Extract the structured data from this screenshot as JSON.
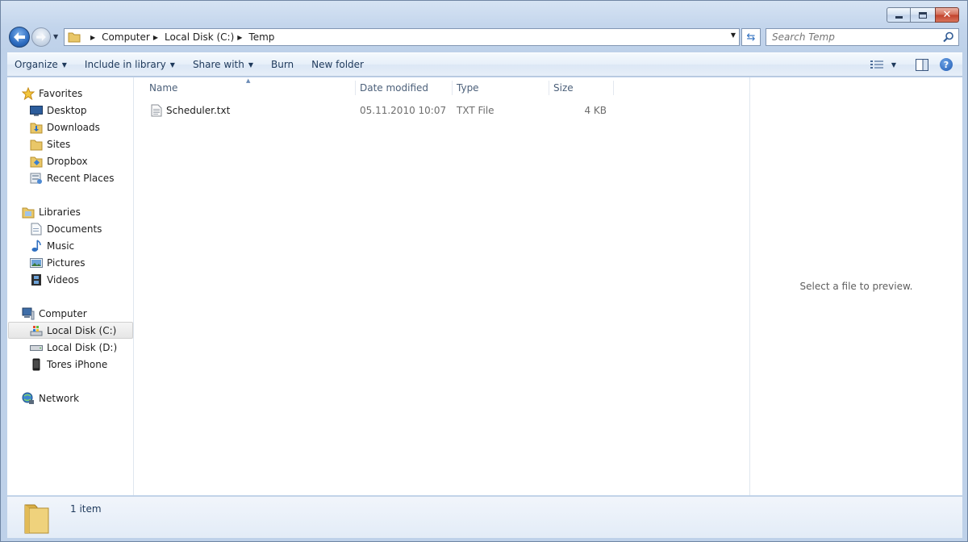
{
  "window": {
    "caption_buttons": [
      "minimize-icon",
      "maximize-icon",
      "close-icon"
    ]
  },
  "address_bar": {
    "breadcrumbs": [
      "Computer",
      "Local Disk (C:)",
      "Temp"
    ]
  },
  "search": {
    "placeholder": "Search Temp"
  },
  "toolbar": {
    "organize_label": "Organize",
    "include_label": "Include in library",
    "share_label": "Share with",
    "burn_label": "Burn",
    "new_folder_label": "New folder"
  },
  "sidebar": {
    "favorites": {
      "label": "Favorites",
      "items": [
        {
          "label": "Desktop",
          "icon": "desktop-icon"
        },
        {
          "label": "Downloads",
          "icon": "downloads-folder-icon"
        },
        {
          "label": "Sites",
          "icon": "folder-icon"
        },
        {
          "label": "Dropbox",
          "icon": "dropbox-folder-icon"
        },
        {
          "label": "Recent Places",
          "icon": "recent-places-icon"
        }
      ]
    },
    "libraries": {
      "label": "Libraries",
      "items": [
        {
          "label": "Documents",
          "icon": "documents-icon"
        },
        {
          "label": "Music",
          "icon": "music-icon"
        },
        {
          "label": "Pictures",
          "icon": "pictures-icon"
        },
        {
          "label": "Videos",
          "icon": "videos-icon"
        }
      ]
    },
    "computer": {
      "label": "Computer",
      "items": [
        {
          "label": "Local Disk (C:)",
          "icon": "system-drive-icon",
          "selected": true
        },
        {
          "label": "Local Disk (D:)",
          "icon": "drive-icon"
        },
        {
          "label": "Tores iPhone",
          "icon": "phone-icon"
        }
      ]
    },
    "network": {
      "label": "Network"
    }
  },
  "file_list": {
    "columns": [
      "Name",
      "Date modified",
      "Type",
      "Size"
    ],
    "rows": [
      {
        "name": "Scheduler.txt",
        "date_modified": "05.11.2010 10:07",
        "type": "TXT File",
        "size": "4 KB",
        "icon": "text-file-icon"
      }
    ]
  },
  "preview": {
    "message": "Select a file to preview."
  },
  "details": {
    "item_count": "1 item"
  },
  "colors": {
    "chrome": "#bed1e9",
    "toolbar_text": "#1e395b",
    "header_text": "#4c607a",
    "close_button": "#c2412c"
  }
}
